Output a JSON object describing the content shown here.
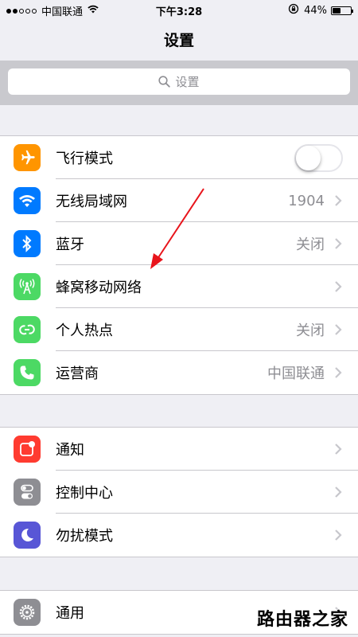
{
  "status_bar": {
    "carrier": "中国联通",
    "time": "下午3:28",
    "battery": "44%",
    "battery_level": 0.44
  },
  "nav": {
    "title": "设置"
  },
  "search": {
    "placeholder": "设置"
  },
  "groups": [
    {
      "rows": [
        {
          "label": "飞行模式",
          "icon": "airplane-icon",
          "color": "#ff9500",
          "toggle": false
        },
        {
          "label": "无线局域网",
          "icon": "wifi-icon",
          "color": "#007aff",
          "value": "1904"
        },
        {
          "label": "蓝牙",
          "icon": "bluetooth-icon",
          "color": "#007aff",
          "value": "关闭"
        },
        {
          "label": "蜂窝移动网络",
          "icon": "cellular-icon",
          "color": "#4cd964",
          "value": ""
        },
        {
          "label": "个人热点",
          "icon": "hotspot-icon",
          "color": "#4cd964",
          "value": "关闭"
        },
        {
          "label": "运营商",
          "icon": "phone-icon",
          "color": "#4cd964",
          "value": "中国联通"
        }
      ]
    },
    {
      "rows": [
        {
          "label": "通知",
          "icon": "notification-icon",
          "color": "#ff3b30"
        },
        {
          "label": "控制中心",
          "icon": "control-center-icon",
          "color": "#8e8e93"
        },
        {
          "label": "勿扰模式",
          "icon": "moon-icon",
          "color": "#5856d6"
        }
      ]
    },
    {
      "rows": [
        {
          "label": "通用",
          "icon": "gear-icon",
          "color": "#8e8e93"
        }
      ]
    }
  ],
  "watermark": "路由器之家",
  "annotation": {
    "color": "#e8141b"
  }
}
